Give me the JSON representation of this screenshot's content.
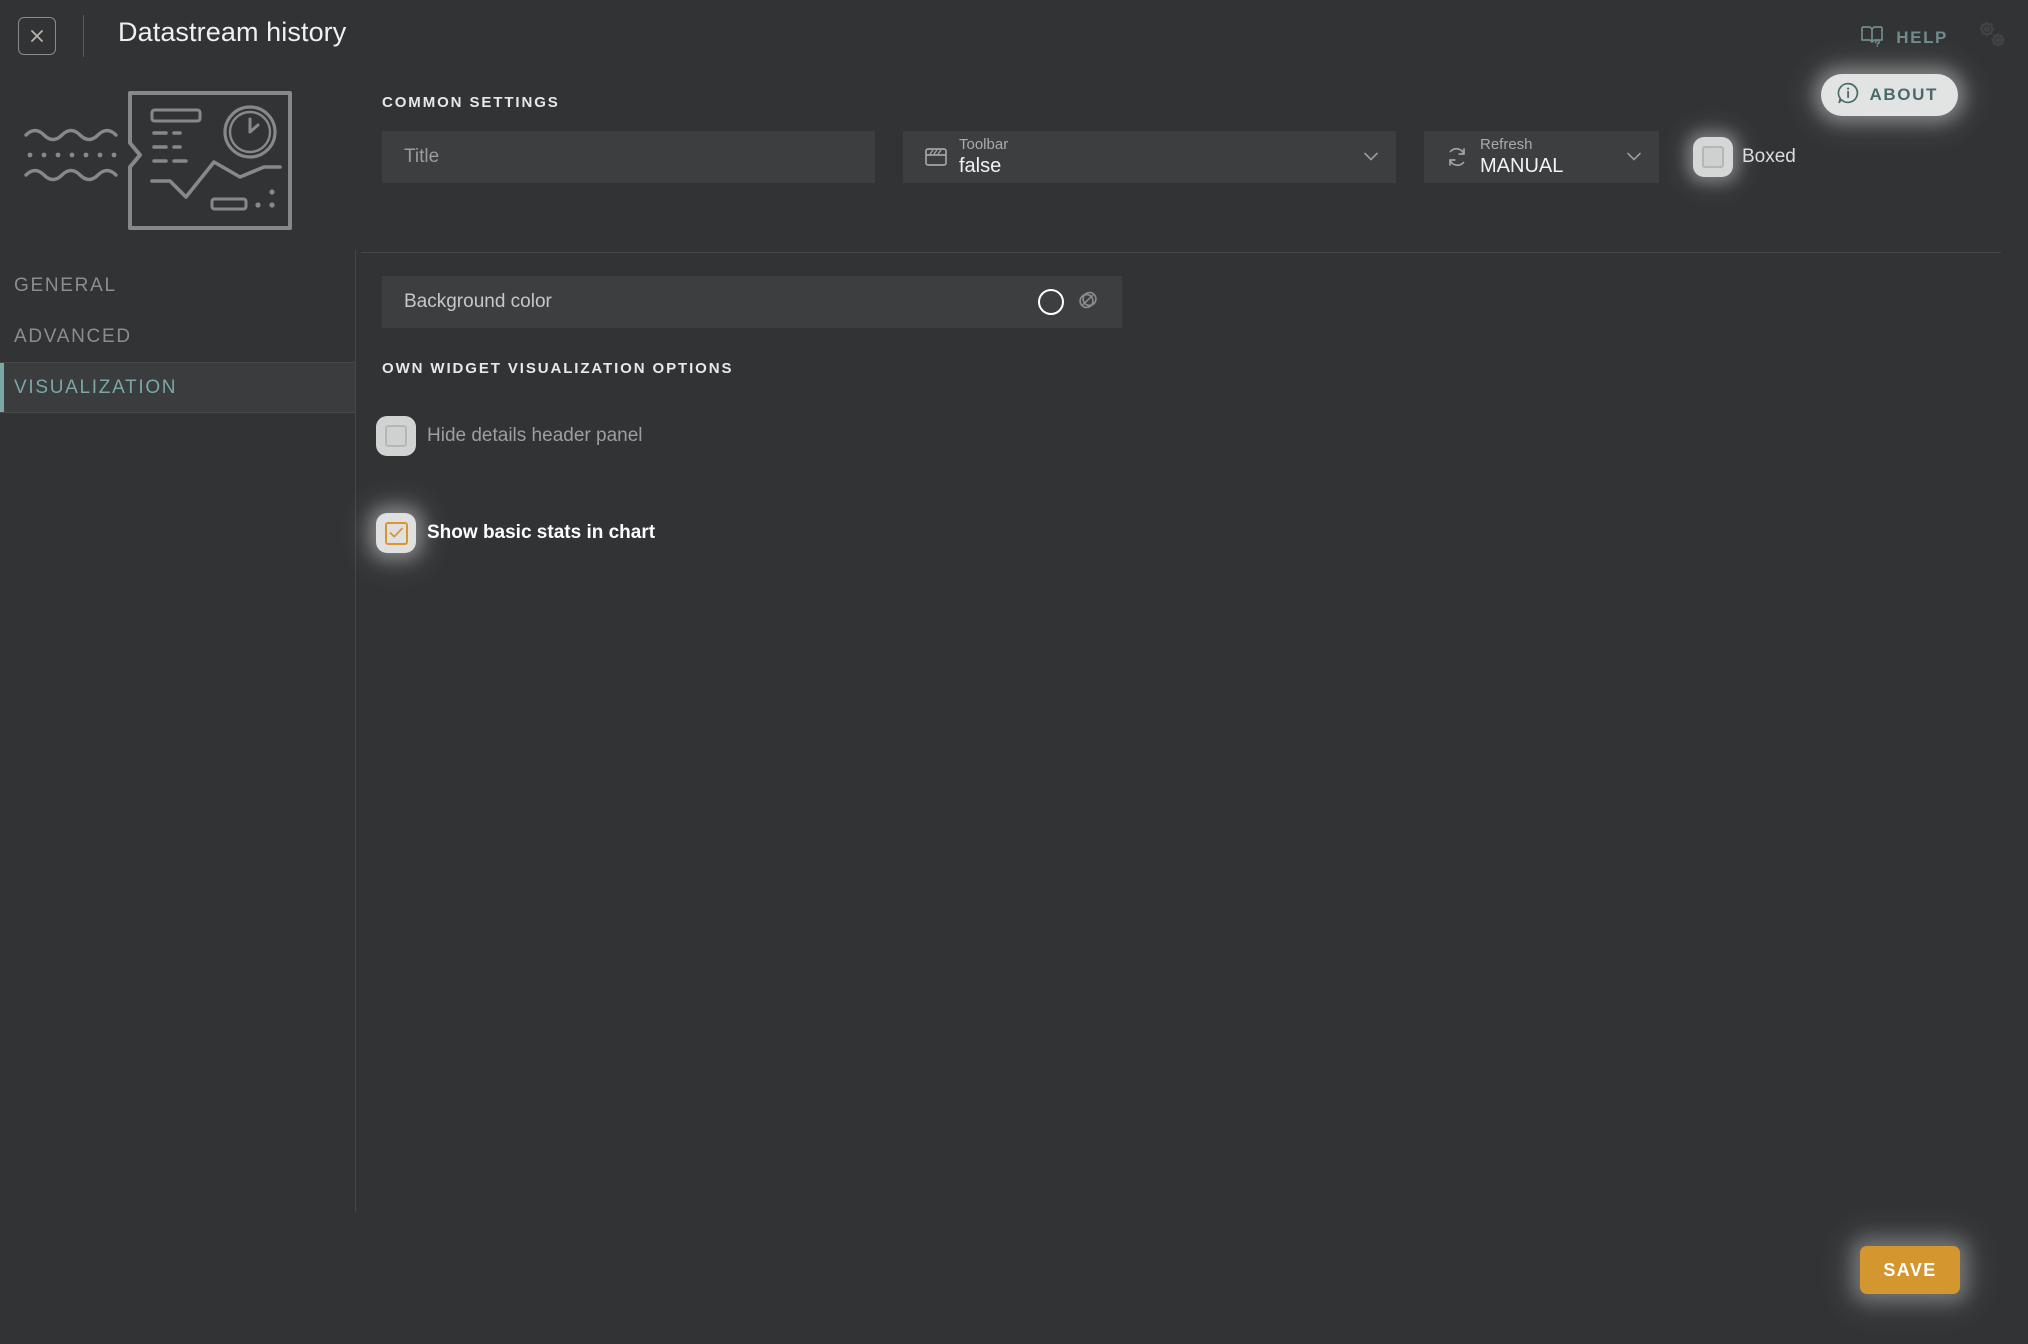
{
  "window": {
    "title": "Datastream history",
    "close_icon": "close-x-icon"
  },
  "topbar": {
    "help_label": "HELP",
    "help_icon": "book-question-icon",
    "about_label": "ABOUT",
    "about_icon": "info-bubble-icon",
    "settings_icon": "gears-icon"
  },
  "sidebar": {
    "illustration_icon": "datastream-chart-illustration",
    "items": [
      {
        "label": "GENERAL",
        "active": false
      },
      {
        "label": "ADVANCED",
        "active": false
      },
      {
        "label": "VISUALIZATION",
        "active": true
      }
    ]
  },
  "main": {
    "common_settings_label": "COMMON SETTINGS",
    "title_field": {
      "value": "",
      "placeholder": "Title"
    },
    "toolbar_select": {
      "caption": "Toolbar",
      "value": "false",
      "icon": "window-toolbar-icon"
    },
    "refresh_select": {
      "caption": "Refresh",
      "value": "MANUAL",
      "icon": "refresh-icon"
    },
    "boxed_checkbox": {
      "label": "Boxed",
      "checked": false
    },
    "background_color": {
      "label": "Background color",
      "swatch_icon": "color-swatch-circle",
      "palette_icon": "opacity-circles-icon"
    },
    "own_options_label": "OWN WIDGET VISUALIZATION OPTIONS",
    "options": [
      {
        "label": "Hide details header panel",
        "checked": false
      },
      {
        "label": "Show basic stats in chart",
        "checked": true
      }
    ]
  },
  "footer": {
    "save_label": "SAVE"
  },
  "colors": {
    "background": "#313335",
    "field": "#3c3e40",
    "accent_teal": "#7ba7a7",
    "accent_amber": "#d4962f",
    "text_primary": "#f0f0f0",
    "text_muted": "#9a9c9c"
  }
}
